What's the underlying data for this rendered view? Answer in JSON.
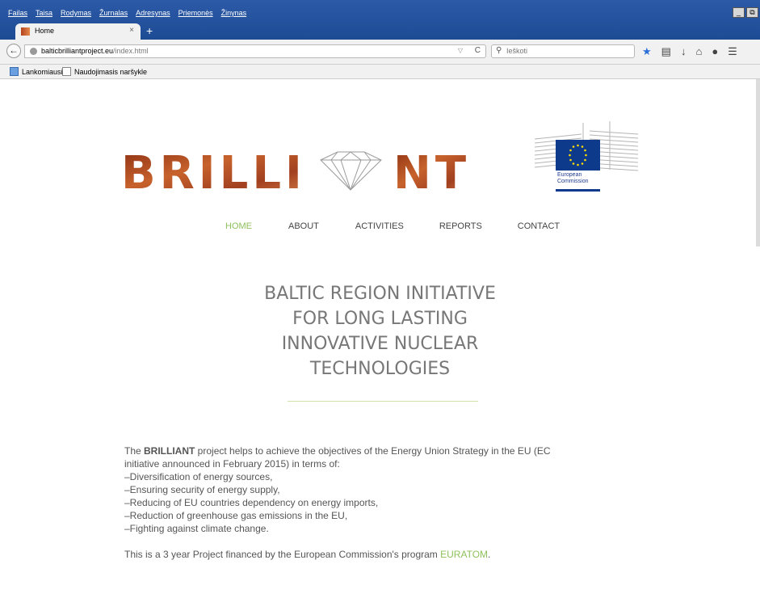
{
  "browser": {
    "menu": [
      "Failas",
      "Taisa",
      "Rodymas",
      "Žurnalas",
      "Adresynas",
      "Priemonės",
      "Žinynas"
    ],
    "window_controls": [
      "_",
      "⧉",
      "x"
    ],
    "tab": {
      "title": "Home",
      "close": "×"
    },
    "new_tab": "+",
    "url": {
      "domain": "balticbrilliantproject.eu",
      "path": "/index.html"
    },
    "search_placeholder": "Ieškoti",
    "bookmarks": [
      "Lankomiausi",
      "Naudojimasis naršykle"
    ],
    "toolbar_icons": [
      "bookmark-star-icon",
      "reading-list-icon",
      "downloads-icon",
      "home-icon",
      "chat-icon",
      "menu-icon"
    ]
  },
  "page": {
    "logo_text": {
      "left": "BRILLI",
      "right": "NT"
    },
    "ec_logo": {
      "line1": "European",
      "line2": "Commission"
    },
    "nav": [
      "HOME",
      "ABOUT",
      "ACTIVITIES",
      "REPORTS",
      "CONTACT"
    ],
    "hero": [
      "BALTIC REGION INITIATIVE",
      "FOR LONG LASTING",
      "INNOVATIVE NUCLEAR",
      "TECHNOLOGIES"
    ],
    "intro": {
      "prefix": "The ",
      "bold": "BRILLIANT",
      "suffix": " project helps to achieve the objectives of the Energy Union Strategy in the EU (EC",
      "line2": "initiative announced in February 2015) in terms of:"
    },
    "objectives": [
      "–Diversification of energy sources,",
      "–Ensuring security of energy supply,",
      "–Reducing of EU countries dependency on energy imports,",
      "–Reduction of greenhouse gas emissions in the EU,",
      "–Fighting against climate change."
    ],
    "financing": {
      "text": "This is a 3 year Project financed by the European Commission's program ",
      "link": "EURATOM",
      "end": "."
    },
    "colors": {
      "accent": "#8fc15b",
      "text": "#555555",
      "brand": "#9b3c1d",
      "eu_blue": "#0e3a8c"
    }
  }
}
